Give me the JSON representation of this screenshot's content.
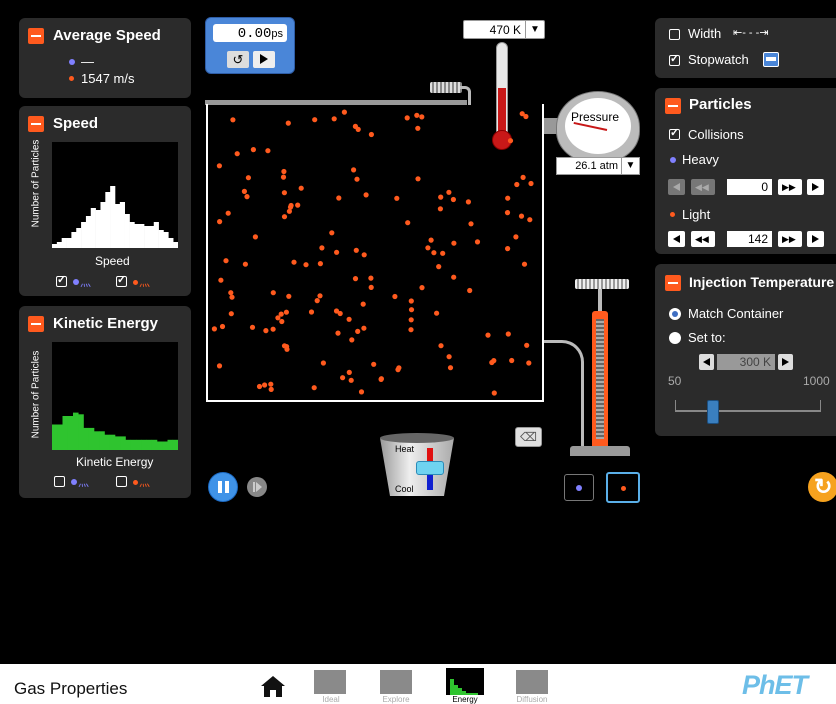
{
  "app": {
    "title": "Gas Properties",
    "logo": "PhET"
  },
  "average_speed": {
    "title": "Average Speed",
    "heavy_value": "—",
    "light_value": "1547 m/s"
  },
  "speed_panel": {
    "title": "Speed",
    "xlabel": "Speed",
    "ylabel": "Number of Particles",
    "heavy_checked": true,
    "light_checked": true
  },
  "ke_panel": {
    "title": "Kinetic Energy",
    "xlabel": "Kinetic Energy",
    "ylabel": "Number of Particles",
    "heavy_checked": false,
    "light_checked": false
  },
  "stopwatch": {
    "time_value": "0.00",
    "time_unit": "ps"
  },
  "thermometer": {
    "value": "470 K"
  },
  "pressure": {
    "label": "Pressure",
    "value": "26.1 atm"
  },
  "heat_cool": {
    "heat_label": "Heat",
    "cool_label": "Cool"
  },
  "options": {
    "width_label": "Width",
    "width_checked": false,
    "stopwatch_label": "Stopwatch",
    "stopwatch_checked": true
  },
  "particles": {
    "title": "Particles",
    "collisions_label": "Collisions",
    "collisions_checked": true,
    "heavy_label": "Heavy",
    "heavy_count": "0",
    "light_label": "Light",
    "light_count": "142"
  },
  "injection": {
    "title": "Injection Temperature",
    "match_label": "Match Container",
    "setto_label": "Set to:",
    "temp_value": "300 K",
    "slider_min": "50",
    "slider_max": "1000",
    "slider_value": 300
  },
  "screens": [
    {
      "label": "Ideal"
    },
    {
      "label": "Explore"
    },
    {
      "label": "Energy",
      "selected": true
    },
    {
      "label": "Diffusion"
    }
  ],
  "colors": {
    "accent": "#ff5a1e",
    "heavy": "#8080ff",
    "light": "#ff5a1e",
    "ke_bars": "#2fc42f",
    "speed_bars": "#ffffff"
  }
}
